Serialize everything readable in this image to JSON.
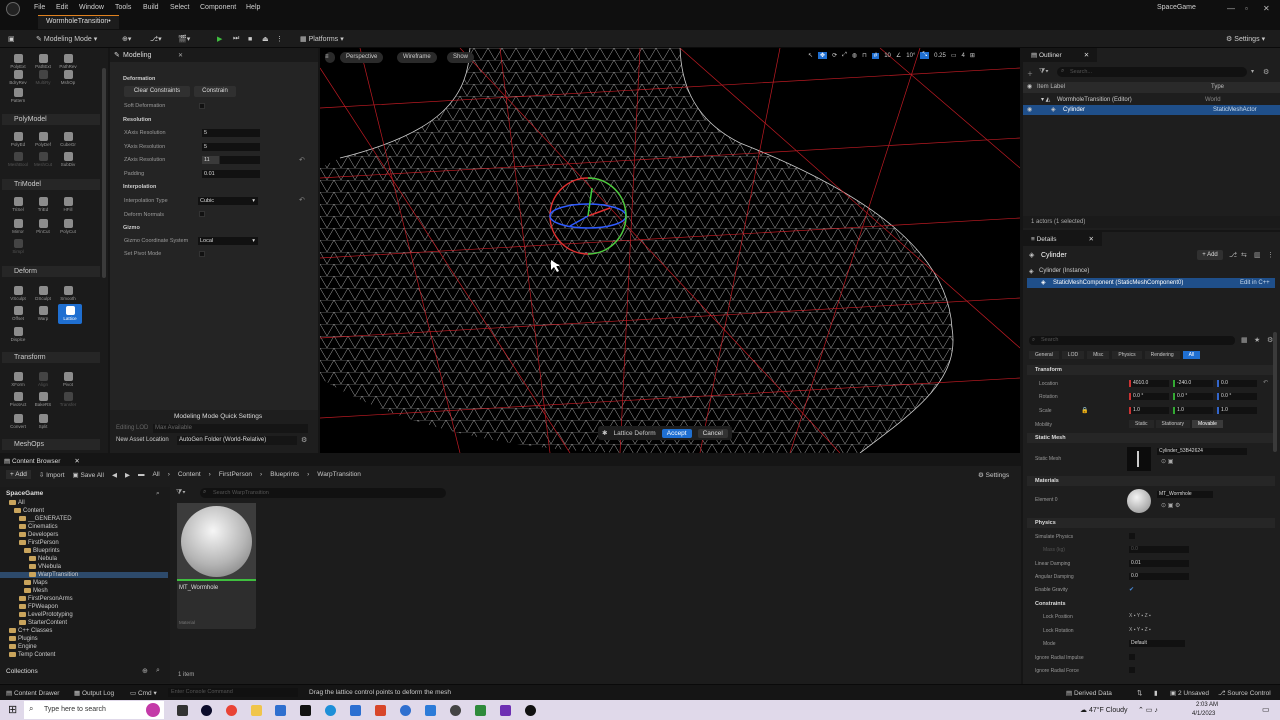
{
  "menubar": {
    "items": [
      "File",
      "Edit",
      "Window",
      "Tools",
      "Build",
      "Select",
      "Component",
      "Help"
    ],
    "tab_title": "WormholeTransition•",
    "project": "SpaceGame"
  },
  "toolbar": {
    "mode_label": "Modeling Mode",
    "platforms_label": "Platforms",
    "settings_label": "Settings"
  },
  "palette": {
    "top_tools": [
      "PolyExt",
      "PathExt",
      "PathRev",
      "BdryRev",
      "MultiRy",
      "MshOp",
      "Pattern"
    ],
    "sections": [
      "PolyModel",
      "TriModel",
      "Deform",
      "Transform",
      "MeshOps"
    ],
    "polymodel_tools": [
      "PolyEd",
      "PolyDef",
      "CubeGr",
      "MeshBool",
      "MeshCut",
      "SubDiv"
    ],
    "trimodel_tools": [
      "TriSel",
      "TriEd",
      "HFill",
      "Mirror",
      "PlnCut",
      "PolyCut",
      "Simpl"
    ],
    "deform_tools": [
      "VSculpt",
      "DSculpt",
      "Smooth",
      "Offset",
      "Warp",
      "Lattice",
      "Displce"
    ],
    "transform_tools": [
      "XForm",
      "Align",
      "Pivot",
      "PivotAct",
      "BakeRS",
      "Transfer",
      "Convert",
      "Split"
    ]
  },
  "modeling": {
    "tab_label": "Modeling",
    "deformation_header": "Deformation",
    "clear_constraints": "Clear Constraints",
    "constrain": "Constrain",
    "soft_deformation_label": "Soft Deformation",
    "resolution_header": "Resolution",
    "xaxis_label": "XAxis Resolution",
    "xaxis_value": "5",
    "yaxis_label": "YAxis Resolution",
    "yaxis_value": "5",
    "zaxis_label": "ZAxis Resolution",
    "zaxis_value": "11",
    "padding_label": "Padding",
    "padding_value": "0.01",
    "interpolation_header": "Interpolation",
    "interp_type_label": "Interpolation Type",
    "interp_type_value": "Cubic",
    "deform_normals_label": "Deform Normals",
    "gizmo_header": "Gizmo",
    "gizmo_coord_label": "Gizmo Coordinate System",
    "gizmo_coord_value": "Local",
    "set_pivot_label": "Set Pivot Mode",
    "quick_settings_label": "Modeling Mode Quick Settings",
    "editing_lod_label": "Editing LOD",
    "editing_lod_value": "Max Available",
    "new_asset_label": "New Asset Location",
    "new_asset_value": "AutoGen Folder (World-Relative)"
  },
  "viewport": {
    "perspective": "Perspective",
    "wireframe": "Wireframe",
    "show": "Show",
    "grid_snap": "10",
    "rot_snap": "10°",
    "scale_snap": "0.25",
    "cam_speed": "4",
    "lattice_label": "Lattice Deform",
    "accept": "Accept",
    "cancel": "Cancel"
  },
  "outliner": {
    "tab": "Outliner",
    "search_placeholder": "Search...",
    "col_label": "Item Label",
    "col_type": "Type",
    "rows": [
      {
        "label": "WormholeTransition (Editor)",
        "type": "World"
      },
      {
        "label": "Cylinder",
        "type": "StaticMeshActor"
      }
    ],
    "footer": "1 actors (1 selected)"
  },
  "details": {
    "tab": "Details",
    "actor_name": "Cylinder",
    "add_label": "+ Add",
    "instance_label": "Cylinder (Instance)",
    "component_label": "StaticMeshComponent (StaticMeshComponent0)",
    "edit_cpp": "Edit in C++",
    "search_placeholder": "Search",
    "filters": [
      "General",
      "LOD",
      "Misc",
      "Physics",
      "Rendering",
      "All"
    ],
    "transform_header": "Transform",
    "location_label": "Location",
    "location": [
      "4010.0",
      "-240.0",
      "0.0"
    ],
    "rotation_label": "Rotation",
    "rotation": [
      "0.0 °",
      "0.0 °",
      "0.0 °"
    ],
    "scale_label": "Scale",
    "scale": [
      "1.0",
      "1.0",
      "1.0"
    ],
    "mobility_label": "Mobility",
    "mobility_options": [
      "Static",
      "Stationary",
      "Movable"
    ],
    "static_mesh_header": "Static Mesh",
    "static_mesh_label": "Static Mesh",
    "static_mesh_value": "Cylinder_53B42624",
    "materials_header": "Materials",
    "element0_label": "Element 0",
    "element0_value": "MT_Wormhole",
    "physics_header": "Physics",
    "simulate_physics": "Simulate Physics",
    "mass_kg": "Mass (kg)",
    "mass_value": "0.0",
    "linear_damping": "Linear Damping",
    "linear_damping_value": "0.01",
    "angular_damping": "Angular Damping",
    "angular_damping_value": "0.0",
    "enable_gravity": "Enable Gravity",
    "constraints_header": "Constraints",
    "lock_position": "Lock Position",
    "lock_rotation": "Lock Rotation",
    "mode_label": "Mode",
    "mode_value": "Default",
    "ignore_radial_impulse": "Ignore Radial Impulse",
    "ignore_radial_force": "Ignore Radial Force"
  },
  "content_browser": {
    "tab": "Content Browser",
    "add": "+ Add",
    "import": "Import",
    "save_all": "Save All",
    "path": [
      "All",
      "Content",
      "FirstPerson",
      "Blueprints",
      "WarpTransition"
    ],
    "settings": "Settings",
    "root": "SpaceGame",
    "search_placeholder": "Search WarpTransition",
    "tree": [
      "All",
      "Content",
      "__GENERATED",
      "Cinematics",
      "Developers",
      "FirstPerson",
      "Blueprints",
      "Nebula",
      "VNebula",
      "WarpTransition",
      "Maps",
      "Mesh",
      "FirstPersonArms",
      "FPWeapon",
      "LevelPrototyping",
      "StarterContent",
      "C++ Classes",
      "Plugins",
      "Engine",
      "Temp Content"
    ],
    "collections": "Collections",
    "asset_name": "MT_Wormhole",
    "asset_type": "Material",
    "item_count": "1 item"
  },
  "statusbar": {
    "content_drawer": "Content Drawer",
    "output_log": "Output Log",
    "cmd": "Cmd",
    "console_placeholder": "Enter Console Command",
    "hint": "Drag the lattice control points to deform the mesh",
    "derived_data": "Derived Data",
    "unsaved": "2 Unsaved",
    "source_control": "Source Control"
  },
  "taskbar": {
    "search_placeholder": "Type here to search",
    "weather": "47°F  Cloudy",
    "time": "2:03 AM",
    "date": "4/1/2023"
  },
  "colors": {
    "accent": "#1f6fd1",
    "mesh_wire": "#ffffff",
    "lattice": "#e0202a",
    "tab_highlight": "#e0821f"
  }
}
